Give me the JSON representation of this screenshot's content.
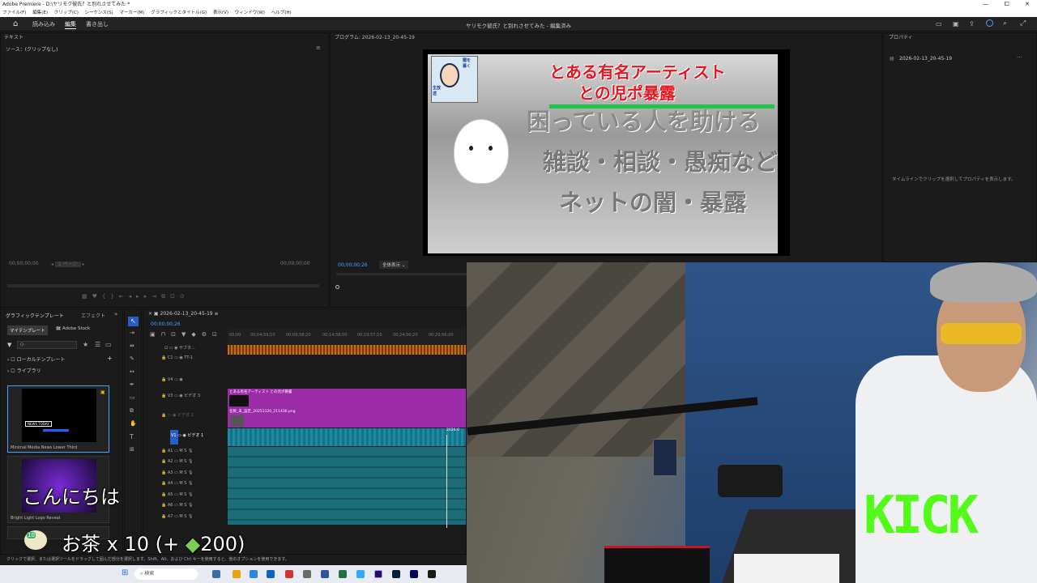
{
  "window": {
    "title": "Adobe Premiere - D:\\ヤリモク彼氏？と別れさせてみた *",
    "controls": [
      "—",
      "⧠",
      "✕"
    ]
  },
  "menu": [
    "ファイル(F)",
    "編集(E)",
    "クリップ(C)",
    "シーケンス(S)",
    "マーカー(M)",
    "グラフィックとタイトル(G)",
    "表示(V)",
    "ウィンドウ(W)",
    "ヘルプ(H)"
  ],
  "nav": {
    "tabs": [
      "読み込み",
      "編集",
      "書き出し"
    ],
    "center_title": "ヤリモク彼氏？と別れさせてみた - 編集済み"
  },
  "source_panel": {
    "tab": "テキスト",
    "source_label": "ソース：(クリップなし)",
    "tc_left": "00;00;00;00",
    "tc_right": "00;00;00;00",
    "page": "1 ページ"
  },
  "program_panel": {
    "tab": "プログラム: 2026-02-13_20-45-19",
    "timecode": "00;00;00;26",
    "fit": "全体表示",
    "frame": {
      "headline1": "とある有名アーティスト",
      "headline2": "との児ポ暴露",
      "line1": "困っている人を助ける",
      "line2": "雑談・相談・愚痴など",
      "line3": "ネットの闇・暴露",
      "badge": [
        "闇を",
        "暴く",
        "生放",
        "送"
      ]
    }
  },
  "properties": {
    "tab": "プロパティ",
    "item": "2026-02-13_20-45-19",
    "empty_msg": "タイムラインでクリップを選択してプロパティを表示します。"
  },
  "graphics_panel": {
    "tabs": [
      "グラフィックテンプレート",
      "エフェクト"
    ],
    "subtabs": [
      "マイテンプレート",
      "Adobe Stock"
    ],
    "search_placeholder": "Q-",
    "tree": [
      "ローカルテンプレート",
      "ライブラリ"
    ],
    "templates": [
      {
        "name": "Minimal Media News Lower Third",
        "thumb_text": "NEWS TODAY"
      },
      {
        "name": "Bright Light Logo Reveal"
      }
    ]
  },
  "timeline": {
    "tab": "2026-02-13_20-45-19",
    "timecode": "00;00;00;26",
    "ruler": [
      "00;00",
      "00;04;59;10",
      "00;09;58;20",
      "00;14;58;00",
      "00;19;57;10",
      "00;24;56;20",
      "00;29;56;00"
    ],
    "tracks": [
      {
        "id": "",
        "name": "サブタ..."
      },
      {
        "id": "C1",
        "name": "TT-1"
      },
      {
        "id": "V4",
        "name": ""
      },
      {
        "id": "V3",
        "name": "ビデオ 3"
      },
      {
        "id": "V2",
        "name": "ビデオ 2"
      },
      {
        "id": "V1",
        "name": "ビデオ 1"
      },
      {
        "id": "A1",
        "name": ""
      },
      {
        "id": "A2",
        "name": ""
      },
      {
        "id": "A3",
        "name": ""
      },
      {
        "id": "A4",
        "name": ""
      },
      {
        "id": "A5",
        "name": ""
      },
      {
        "id": "A6",
        "name": ""
      },
      {
        "id": "A7",
        "name": ""
      }
    ],
    "clips": {
      "v3": "とある有名アーティスト との児ポ暴露",
      "v2": "名称_未_設定_20251120_211436.png",
      "v1_end": "2026-0"
    }
  },
  "status_bar": "クリックで選択、または選択ツールをドラッグして囲んだ部分を選択します。Shift、Alt、および Ctrl キーを使用すると、他のオプションを使用できます。",
  "taskbar": {
    "search": "検索"
  },
  "stream": {
    "greeting": "こんにちは",
    "gift": "お茶 x 10 (+",
    "gift_points": "200)",
    "gift_badge": "10",
    "kick": "KICK"
  },
  "colors": {
    "kick_green": "#53fc18",
    "premiere_blue": "#4aa3ff",
    "clip_purple": "#9b2ba6",
    "clip_teal": "#1c8aa0",
    "headline_red": "#e8141f"
  }
}
